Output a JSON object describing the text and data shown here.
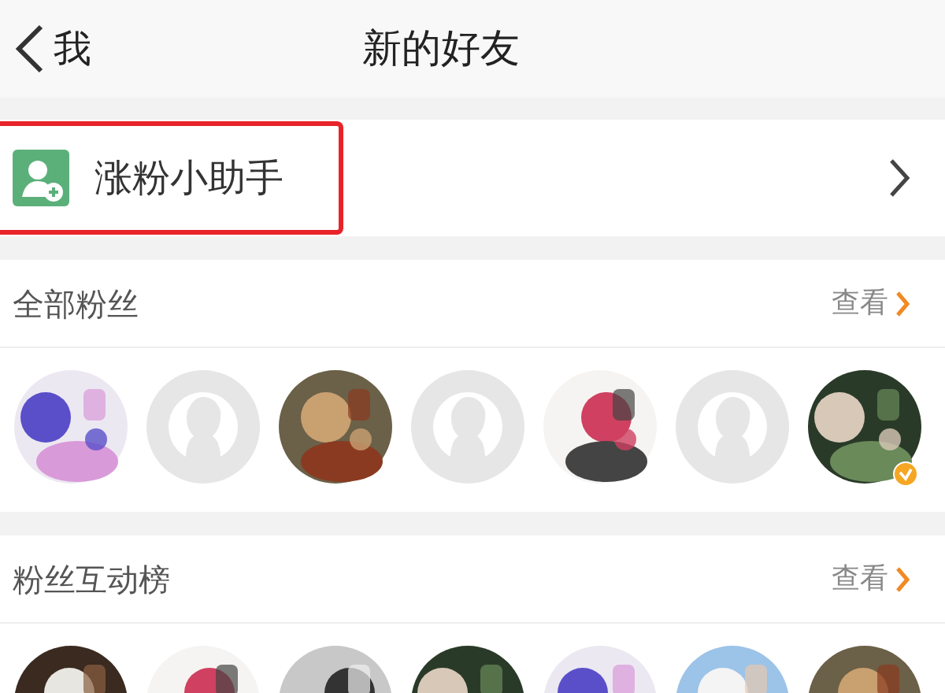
{
  "nav_bar": {
    "back_label": "我",
    "title": "新的好友"
  },
  "helper_row": {
    "label": "涨粉小助手",
    "highlighted": true
  },
  "sections": [
    {
      "title": "全部粉丝",
      "action": "查看",
      "avatars": [
        {
          "kind": "picture",
          "verified": false
        },
        {
          "kind": "default",
          "verified": false
        },
        {
          "kind": "picture",
          "verified": false
        },
        {
          "kind": "default",
          "verified": false
        },
        {
          "kind": "picture",
          "verified": false
        },
        {
          "kind": "default",
          "verified": false
        },
        {
          "kind": "picture",
          "verified": true
        }
      ]
    },
    {
      "title": "粉丝互动榜",
      "action": "查看",
      "avatars": [
        {
          "kind": "picture",
          "verified": false
        },
        {
          "kind": "picture",
          "verified": false
        },
        {
          "kind": "picture",
          "verified": false
        },
        {
          "kind": "picture",
          "verified": false
        },
        {
          "kind": "picture",
          "verified": false
        },
        {
          "kind": "picture",
          "verified": false
        },
        {
          "kind": "picture",
          "verified": false
        }
      ]
    }
  ]
}
